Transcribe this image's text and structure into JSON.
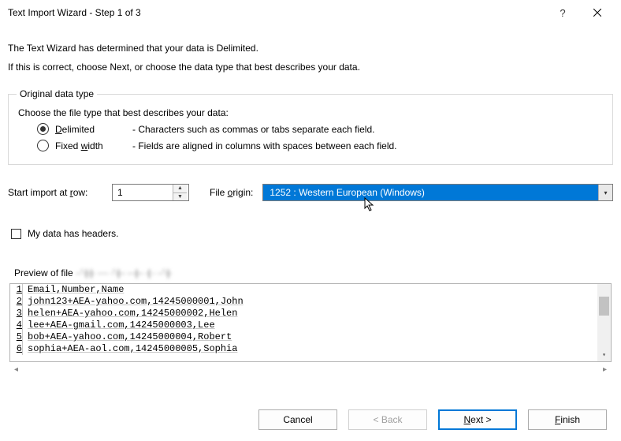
{
  "title": "Text Import Wizard - Step 1 of 3",
  "intro": {
    "line1": "The Text Wizard has determined that your data is Delimited.",
    "line2": "If this is correct, choose Next, or choose the data type that best describes your data."
  },
  "group": {
    "legend": "Original data type",
    "prompt": "Choose the file type that best describes your data:",
    "delimited": {
      "label_pre": "",
      "label_ul": "D",
      "label_post": "elimited",
      "desc": "- Characters such as commas or tabs separate each field."
    },
    "fixed": {
      "label_pre": "Fixed ",
      "label_ul": "w",
      "label_post": "idth",
      "desc": "- Fields are aligned in columns with spaces between each field."
    }
  },
  "start_row": {
    "label_pre": "Start import at ",
    "label_ul": "r",
    "label_post": "ow:",
    "value": "1"
  },
  "file_origin": {
    "label_pre": "File ",
    "label_ul": "o",
    "label_post": "rigin:",
    "value": "1252 : Western European (Windows)"
  },
  "headers_check": {
    "label_ul": "M",
    "label_post": "y data has headers."
  },
  "preview": {
    "label": "Preview of file ",
    "path_blur": "··'·|·|· ···· ·'·|·· ···|·· ·|  · ··'·|·",
    "lines": [
      "Email,Number,Name",
      "john123+AEA-yahoo.com,14245000001,John",
      "helen+AEA-yahoo.com,14245000002,Helen",
      "lee+AEA-gmail.com,14245000003,Lee",
      "bob+AEA-yahoo.com,14245000004,Robert",
      "sophia+AEA-aol.com,14245000005,Sophia"
    ]
  },
  "buttons": {
    "cancel": "Cancel",
    "back": "< Back",
    "next_ul": "N",
    "next_post": "ext >",
    "finish_ul": "F",
    "finish_post": "inish"
  }
}
